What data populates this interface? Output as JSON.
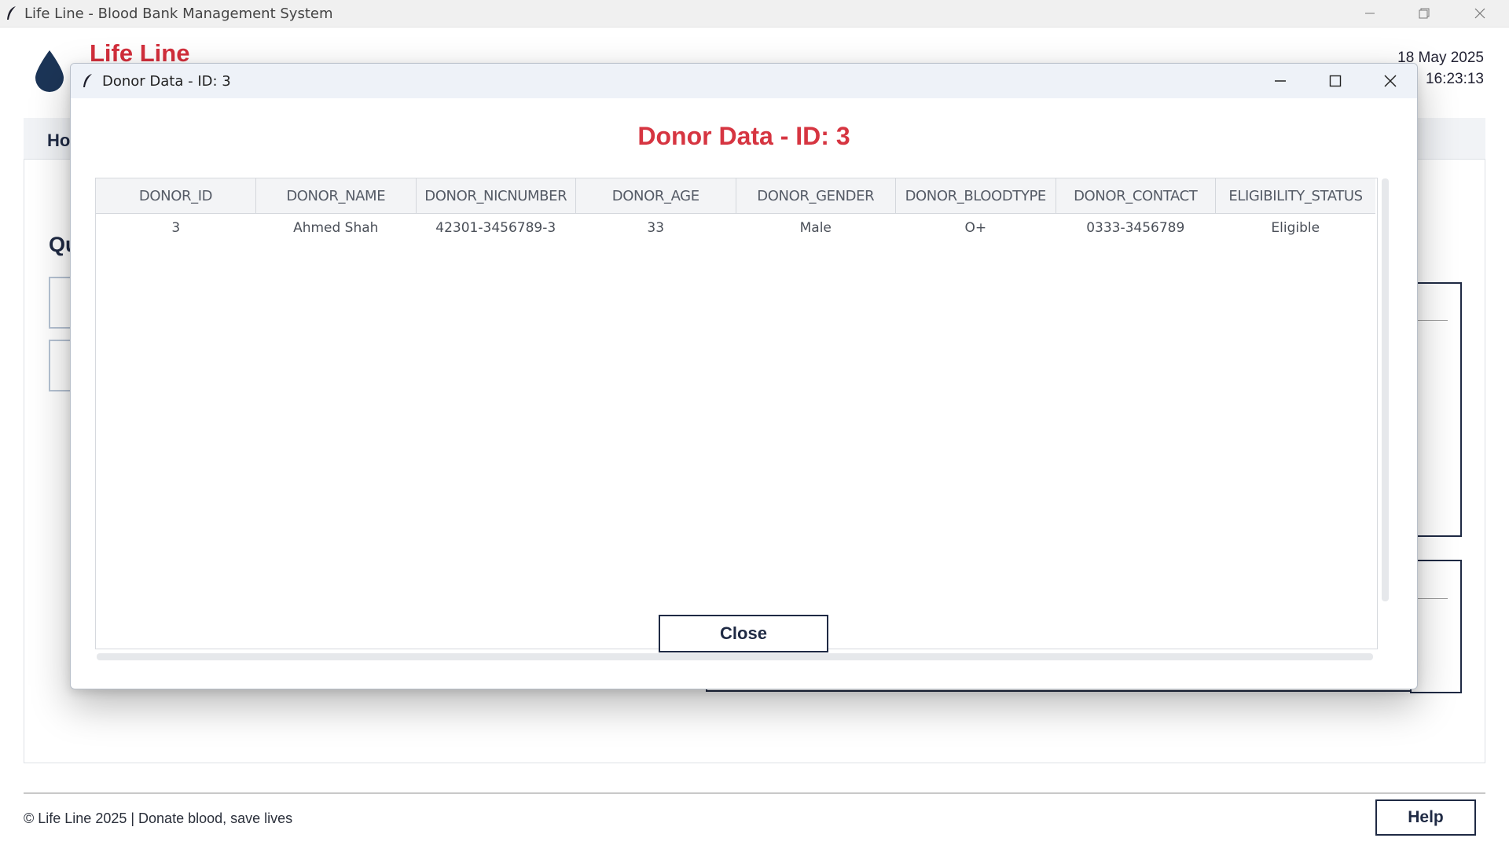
{
  "window": {
    "title": "Life Line - Blood Bank Management System"
  },
  "header": {
    "brand": "Life Line",
    "date": "18 May 2025",
    "time": "16:23:13"
  },
  "nav": {
    "home_label": "Ho"
  },
  "quick_actions": {
    "title": "Qu"
  },
  "footer": {
    "copyright": "© Life Line 2025 | Donate blood, save lives",
    "help_label": "Help"
  },
  "dialog": {
    "window_title": "Donor Data - ID: 3",
    "heading": "Donor Data - ID: 3",
    "close_label": "Close",
    "columns": [
      "DONOR_ID",
      "DONOR_NAME",
      "DONOR_NICNUMBER",
      "DONOR_AGE",
      "DONOR_GENDER",
      "DONOR_BLOODTYPE",
      "DONOR_CONTACT",
      "ELIGIBILITY_STATUS"
    ],
    "rows": [
      [
        "3",
        "Ahmed Shah",
        "42301-3456789-3",
        "33",
        "Male",
        "O+",
        "0333-3456789",
        "Eligible"
      ]
    ]
  },
  "colors": {
    "brand_red": "#d32f3c",
    "navy": "#1f2a44",
    "drop_blue": "#1c3557"
  }
}
